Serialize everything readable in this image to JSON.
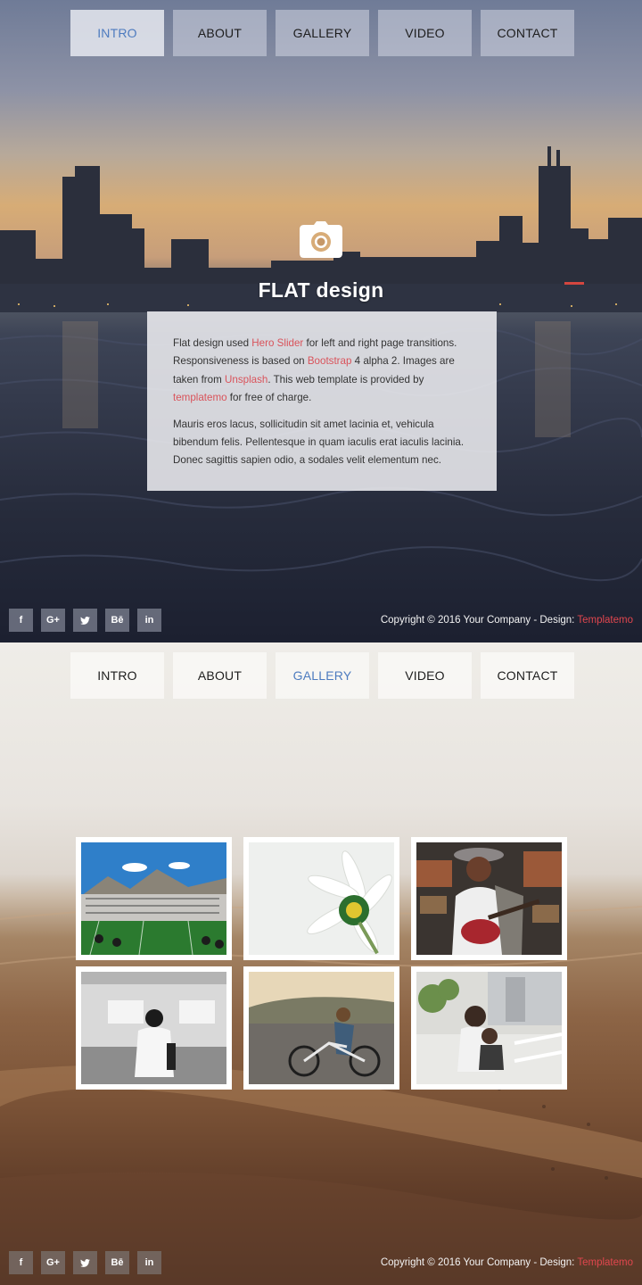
{
  "nav": {
    "items": [
      "INTRO",
      "ABOUT",
      "GALLERY",
      "VIDEO",
      "CONTACT"
    ]
  },
  "intro": {
    "title": "FLAT design",
    "icon": "camera-icon",
    "paragraph1": {
      "t1": "Flat design used ",
      "link1": "Hero Slider",
      "t2": " for left and right page transitions. Responsiveness is based on ",
      "link2": "Bootstrap",
      "t3": " 4 alpha 2. Images are taken from ",
      "link3": "Unsplash",
      "t4": ". This web template is provided by ",
      "link4": "templatemo",
      "t5": " for free of charge."
    },
    "paragraph2": "Mauris eros lacus, sollicitudin sit amet lacinia et, vehicula bibendum felis. Pellentesque in quam iaculis erat iaculis lacinia. Donec sagittis sapien odio, a sodales velit elementum nec."
  },
  "gallery": {
    "active_tab": "GALLERY"
  },
  "social": {
    "items": [
      "f",
      "G+",
      "t",
      "Bē",
      "in"
    ],
    "icons": [
      "facebook-icon",
      "google-plus-icon",
      "twitter-icon",
      "behance-icon",
      "linkedin-icon"
    ]
  },
  "footer": {
    "copyright_text": "Copyright © 2016 Your Company - Design: ",
    "design_link": "Templatemo"
  },
  "colors": {
    "active_nav": "#4d7bbf",
    "link": "#d9535b",
    "footer_link": "#e0464e"
  }
}
